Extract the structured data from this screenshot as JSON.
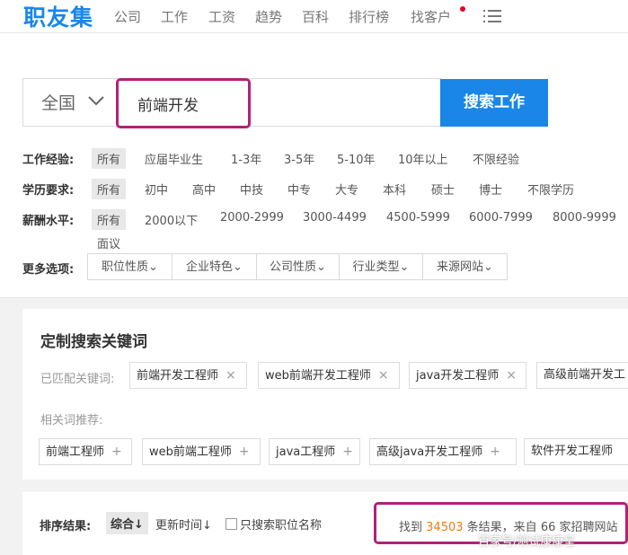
{
  "nav": {
    "logo": "职友集",
    "items": [
      "公司",
      "工作",
      "工资",
      "趋势",
      "百科",
      "排行榜",
      "找客户"
    ]
  },
  "search": {
    "region": "全国",
    "query": "前端开发",
    "button": "搜索工作"
  },
  "filters": {
    "experience": {
      "label": "工作经验:",
      "options": [
        "所有",
        "应届毕业生",
        "1-3年",
        "3-5年",
        "5-10年",
        "10年以上",
        "不限经验"
      ]
    },
    "education": {
      "label": "学历要求:",
      "options": [
        "所有",
        "初中",
        "高中",
        "中技",
        "中专",
        "大专",
        "本科",
        "硕士",
        "博士",
        "不限学历"
      ]
    },
    "salary": {
      "label": "薪酬水平:",
      "options": [
        "所有",
        "2000以下",
        "2000-2999",
        "3000-4499",
        "4500-5999",
        "6000-7999",
        "8000-9999",
        "面议"
      ]
    },
    "more": {
      "label": "更多选项:",
      "dropdowns": [
        "职位性质",
        "企业特色",
        "公司性质",
        "行业类型",
        "来源网站"
      ]
    }
  },
  "keywords": {
    "title": "定制搜索关键词",
    "matched_label": "已匹配关键词:",
    "matched": [
      "前端开发工程师",
      "web前端开发工程师",
      "java开发工程师",
      "高级前端开发工"
    ],
    "related_label": "相关词推荐:",
    "related": [
      "前端工程师",
      "web前端工程师",
      "java工程师",
      "高级java开发工程师",
      "软件开发工程师"
    ]
  },
  "sort": {
    "label": "排序结果:",
    "selected": "综合↓",
    "option": "更新时间↓",
    "checkbox_label": "只搜索职位名称",
    "result_prefix": "找到",
    "result_count": "34503",
    "result_mid": "条结果，来自",
    "site_count": "66",
    "result_suffix": "家招聘网站"
  },
  "watermark": "百家号/测试康康呈",
  "colors": {
    "brand": "#1a86e8",
    "highlight": "#b3207a",
    "count": "#f07b12"
  }
}
